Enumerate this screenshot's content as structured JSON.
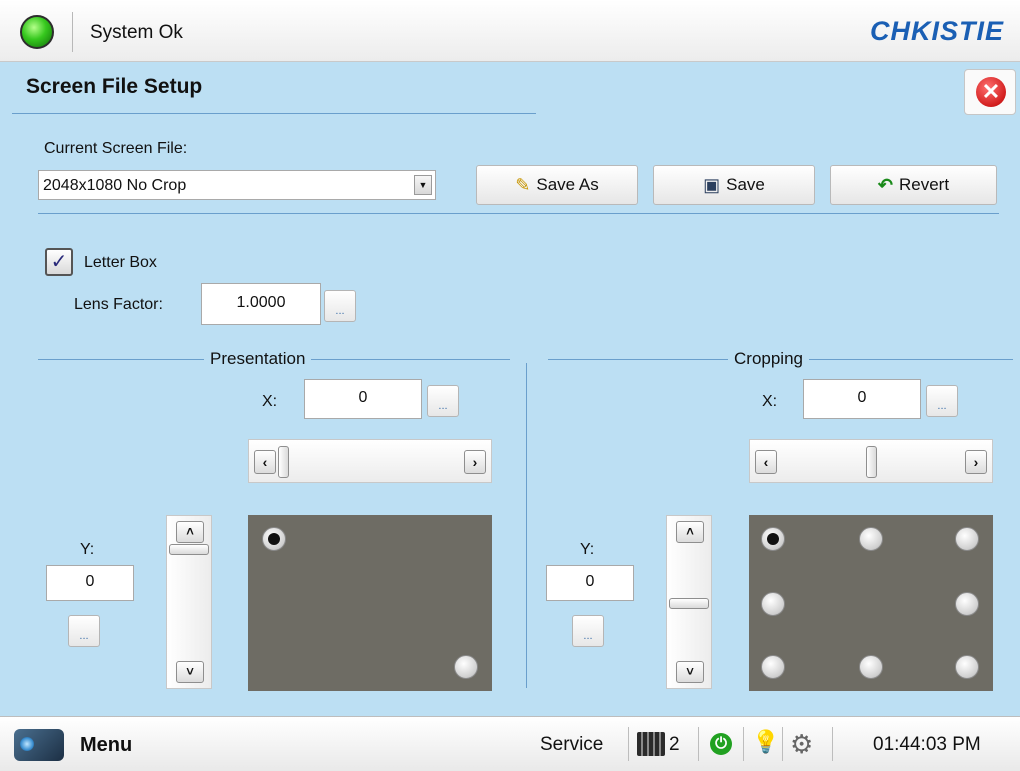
{
  "status": {
    "text": "System Ok",
    "led_color": "#36c81e"
  },
  "brand": {
    "logo": "CHKISTIE"
  },
  "page": {
    "title": "Screen File Setup",
    "close_icon": "close-icon"
  },
  "screen_file": {
    "label": "Current Screen File:",
    "selected": "2048x1080 No Crop"
  },
  "buttons": {
    "save_as": "Save As",
    "save": "Save",
    "revert": "Revert"
  },
  "letter_box": {
    "label": "Letter Box",
    "checked": true
  },
  "lens_factor": {
    "label": "Lens Factor:",
    "value": "1.0000"
  },
  "presentation": {
    "title": "Presentation",
    "x_label": "X:",
    "x_value": "0",
    "y_label": "Y:",
    "y_value": "0",
    "selected_position": "top-left"
  },
  "cropping": {
    "title": "Cropping",
    "x_label": "X:",
    "x_value": "0",
    "y_label": "Y:",
    "y_value": "0",
    "selected_position": "top-left"
  },
  "ellipsis": "...",
  "footer": {
    "menu_label": "Menu",
    "mode": "Service",
    "channel": "2",
    "time": "01:44:03 PM"
  }
}
